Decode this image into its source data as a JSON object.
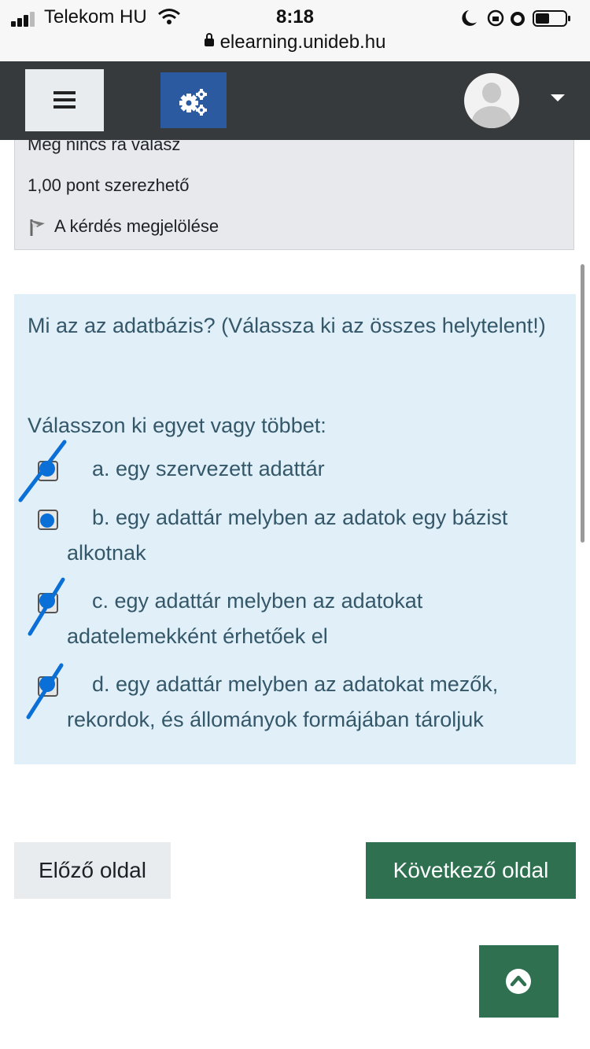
{
  "status_bar": {
    "carrier": "Telekom HU",
    "time": "8:18",
    "url": "elearning.unideb.hu"
  },
  "navbar": {
    "menu_icon": "hamburger-icon",
    "settings_icon": "gears-icon",
    "avatar_icon": "user-avatar-icon"
  },
  "question_info": {
    "state": "Még nincs rá válasz",
    "points": "1,00 pont szerezhető",
    "flag_label": "A kérdés megjelölése"
  },
  "question": {
    "text": "Mi az az adatbázis? (Válassza ki az összes helytelent!)",
    "prompt": "Válasszon ki egyet vagy többet:",
    "options": [
      {
        "label": "a. egy szervezett adattár",
        "checked": true
      },
      {
        "label": "b. egy adattár melyben az adatok egy bázist alkotnak",
        "checked": false
      },
      {
        "label": "c. egy adattár melyben az adatokat adatelemekként érhetőek el",
        "checked": true
      },
      {
        "label": "d. egy adattár melyben az adatokat mezők, rekordok, és állományok formájában tároljuk",
        "checked": true
      }
    ]
  },
  "navigation": {
    "prev": "Előző oldal",
    "next": "Következő oldal",
    "back_to_top_icon": "chevron-up-icon"
  },
  "colors": {
    "navbar": "#373a3c",
    "question_bg": "#e1f0f8",
    "question_text": "#34576a",
    "primary_green": "#2e7050",
    "settings_blue": "#2c5aa0",
    "annotation_blue": "#0a6fd6"
  }
}
